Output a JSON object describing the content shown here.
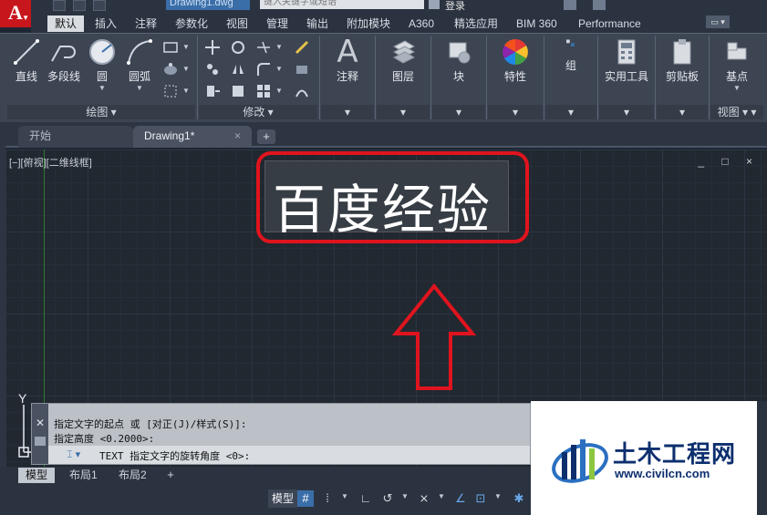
{
  "titlebar": {
    "app_logo": "A",
    "drawing_title": "Drawing1.dwg",
    "search_placeholder": "键入关键字或短语",
    "login": "登录"
  },
  "ribbon_tabs": [
    "默认",
    "插入",
    "注释",
    "参数化",
    "视图",
    "管理",
    "输出",
    "附加模块",
    "A360",
    "精选应用",
    "BIM 360",
    "Performance"
  ],
  "ribbon": {
    "draw_tools": {
      "line": "直线",
      "polyline": "多段线",
      "circle": "圆",
      "arc": "圆弧"
    },
    "draw_panel_title": "绘图",
    "modify_panel_title": "修改",
    "big_panels": [
      {
        "label": "注释"
      },
      {
        "label": "图层"
      },
      {
        "label": "块"
      },
      {
        "label": "特性"
      },
      {
        "label": "组"
      },
      {
        "label": "实用工具"
      },
      {
        "label": "剪贴板"
      },
      {
        "label": "基点"
      }
    ],
    "view_panel_title": "视图"
  },
  "doc_tabs": {
    "start": "开始",
    "drawing": "Drawing1*",
    "close": "×",
    "add": "+"
  },
  "viewport": {
    "label": "[−][俯视][二维线框]",
    "controls": "_ □ ×",
    "text_object": "百度经验",
    "ucs_y": "Y"
  },
  "command_line": {
    "lines": [
      "指定文字的起点 或 [对正(J)/样式(S)]:",
      "指定高度 <0.2000>:"
    ],
    "prompt": "TEXT 指定文字的旋转角度 <0>:"
  },
  "layout_tabs": [
    "模型",
    "布局1",
    "布局2"
  ],
  "layout_add": "+",
  "statusbar": {
    "model": "模型"
  },
  "watermark": {
    "title": "土木工程网",
    "url": "www.civilcn.com"
  },
  "colors": {
    "highlight": "#e0141e",
    "accent": "#3a6ea8",
    "canvas": "#212830"
  }
}
